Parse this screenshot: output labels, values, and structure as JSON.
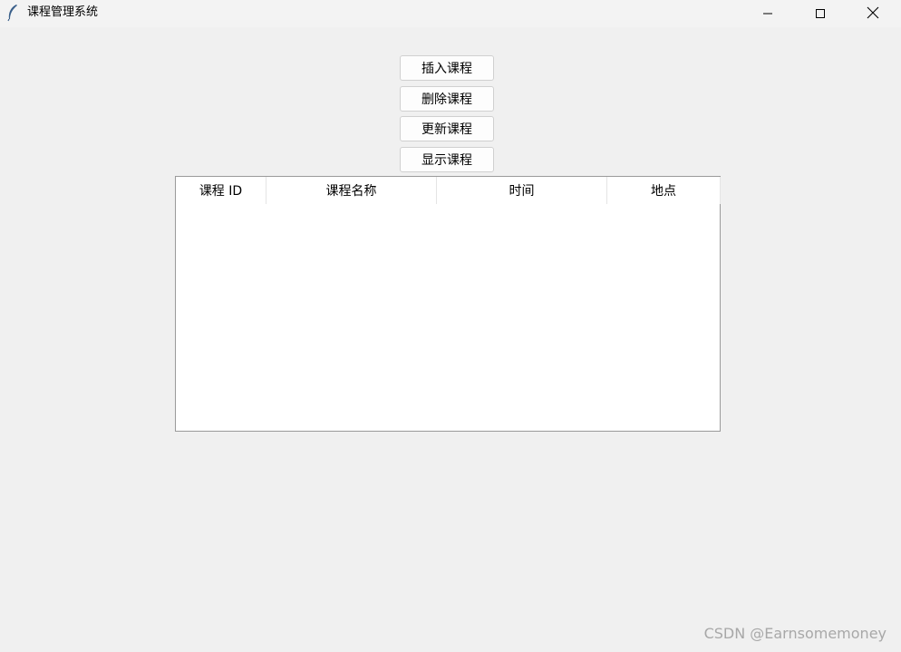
{
  "window": {
    "title": "课程管理系统",
    "icon": "feather-icon",
    "controls": [
      "minimize-icon",
      "maximize-icon",
      "close-icon"
    ]
  },
  "buttons": {
    "insert": "插入课程",
    "delete": "删除课程",
    "update": "更新课程",
    "show": "显示课程"
  },
  "table": {
    "columns": [
      "课程 ID",
      "课程名称",
      "时间",
      "地点"
    ],
    "rows": []
  },
  "watermark": "CSDN @Earnsomemoney"
}
